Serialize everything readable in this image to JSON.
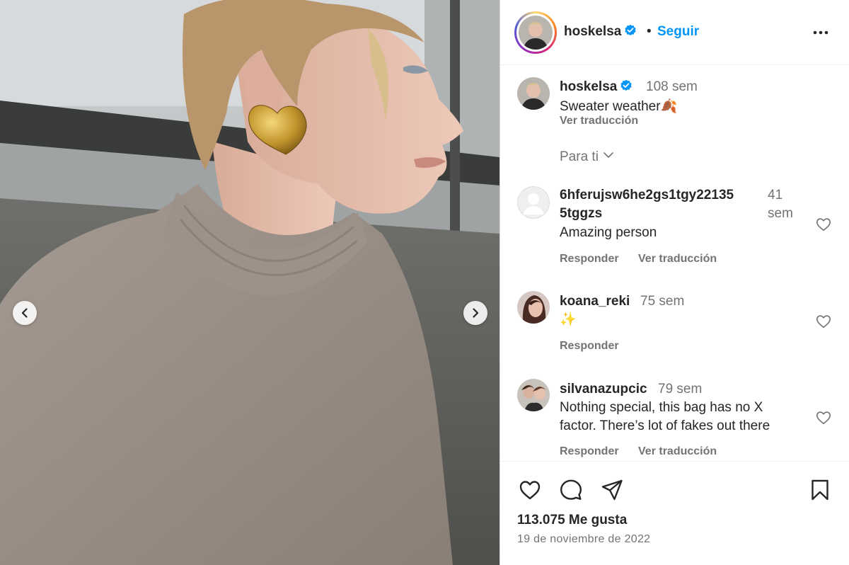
{
  "post": {
    "username": "hoskelsa",
    "follow_label": "Seguir",
    "separator": "•",
    "more_label": "Más opciones"
  },
  "caption": {
    "username": "hoskelsa",
    "time": "108 sem",
    "text": "Sweater weather🍂",
    "translate_label": "Ver traducción"
  },
  "filter": {
    "label": "Para ti"
  },
  "comments": [
    {
      "username_line1": "6hferujsw6he2gs1tgy22135",
      "username_line2": "5tggzs",
      "time_line1": "41",
      "time_line2": "sem",
      "text": "Amazing person",
      "reply_label": "Responder",
      "translate_label": "Ver traducción"
    },
    {
      "username": "koana_reki",
      "time": "75 sem",
      "text": "✨",
      "reply_label": "Responder"
    },
    {
      "username": "silvanazupcic",
      "time": "79 sem",
      "text_line1": "Nothing special, this bag has no X",
      "text_line2": "factor. There’s lot of fakes out there",
      "reply_label": "Responder",
      "translate_label": "Ver traducción"
    }
  ],
  "footer": {
    "likes": "113.075 Me gusta",
    "date": "19 de noviembre de 2022"
  },
  "colors": {
    "accent": "#0095f6",
    "text": "#262626",
    "secondary": "#737373",
    "verified": "#0095f6"
  },
  "icons": [
    "chevron-left-icon",
    "chevron-right-icon",
    "verified-badge-icon",
    "more-icon",
    "chevron-down-icon",
    "heart-icon",
    "comment-icon",
    "share-icon",
    "bookmark-icon"
  ]
}
